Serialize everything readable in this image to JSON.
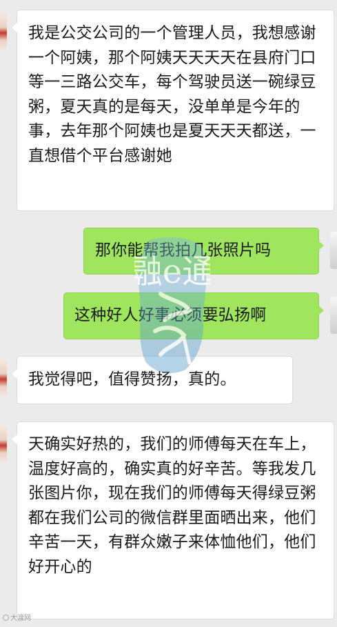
{
  "conversation": {
    "messages": [
      {
        "side": "incoming",
        "text": "我是公交公司的一个管理人员，我想感谢一个阿姨，那个阿姨天天天天在县府门口等一三路公交车，每个驾驶员送一碗绿豆粥，夏天真的是每天，没单单是今年的事，去年那个阿姨也是夏天天天都送，一直想借个平台感谢她"
      },
      {
        "side": "outgoing",
        "text": "那你能帮我拍几张照片吗"
      },
      {
        "side": "outgoing",
        "text": "这种好人好事必须要弘扬啊"
      },
      {
        "side": "incoming",
        "text": "我觉得吧，值得赞扬，真的。"
      },
      {
        "side": "incoming",
        "text": "天确实好热的，我们的师傅每天在车上，温度好高的，确实真的好辛苦。等我发几张图片你，现在我们的师傅每天得绿豆粥都在我们公司的微信群里面晒出来，他们辛苦一天，有群众嫩子来体恤他们，他们好开心的"
      }
    ]
  },
  "watermark": {
    "text": "融e通"
  },
  "footer": {
    "source_mark": "大渡网"
  },
  "colors": {
    "background": "#ebebeb",
    "incoming_bubble": "#ffffff",
    "outgoing_bubble": "#9fe65e",
    "watermark": "#6aaed6"
  }
}
